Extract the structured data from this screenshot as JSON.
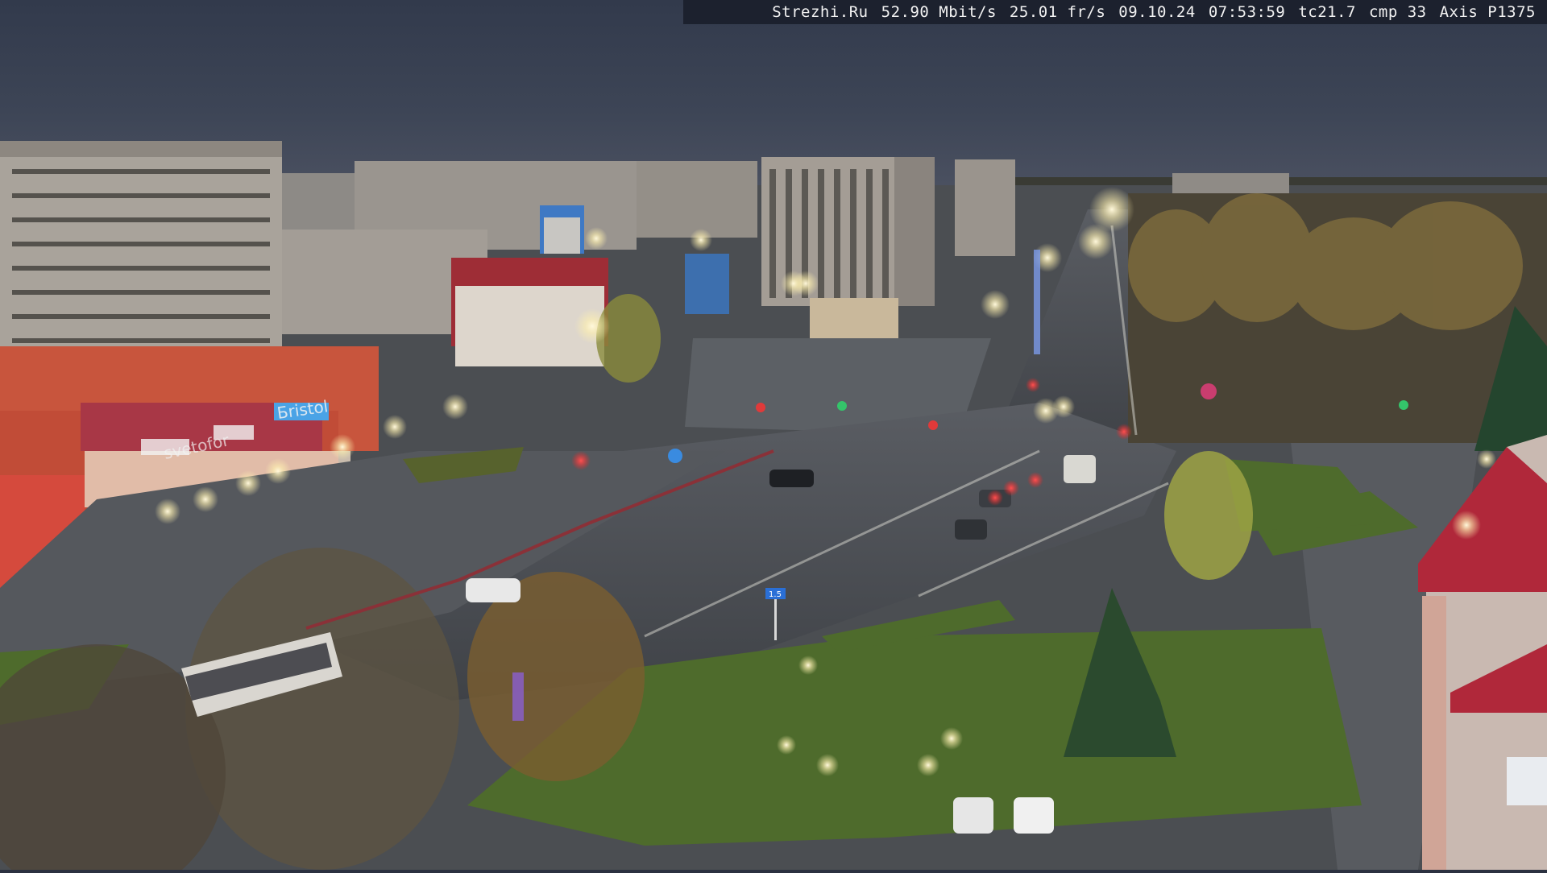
{
  "camera_overlay": {
    "site": "Strezhi.Ru",
    "bitrate": "52.90 Mbit/s",
    "framerate": "25.01 fr/s",
    "date": "09.10.24",
    "time": "07:53:59",
    "tc": "tc21.7",
    "cmp": "cmp 33",
    "camera_model": "Axis P1375"
  },
  "signs": {
    "store_sign_left": "svetofor",
    "store_sign_right": "Бristol",
    "road_sign": "1.5"
  },
  "colors": {
    "sky": "#2c3446",
    "asphalt": "#4a4d52",
    "grass": "#4e6b2c",
    "street_light": "#fff6d8",
    "store_facade": "#c8553d",
    "roof_red": "#b0283a"
  }
}
